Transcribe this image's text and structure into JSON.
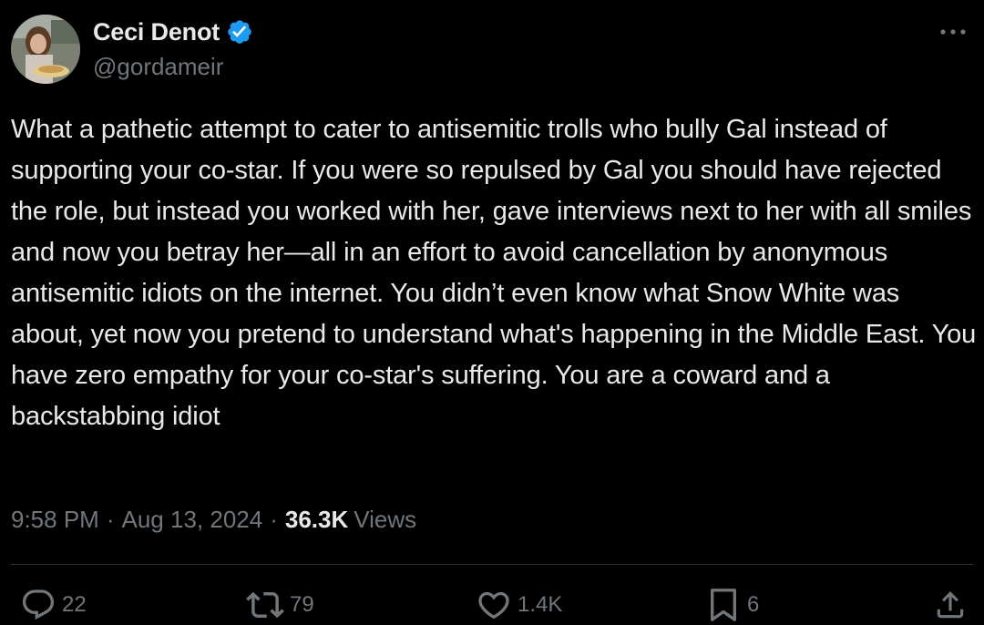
{
  "author": {
    "display_name": "Ceci Denot",
    "handle": "@gordameir",
    "verified": true
  },
  "tweet": {
    "text": "What a pathetic attempt to cater to antisemitic trolls who bully Gal instead of supporting your co-star. If you were so repulsed by Gal you should have rejected the role, but instead you worked with her, gave interviews next to her with all smiles and now you betray her—all in an effort to avoid cancellation by anonymous antisemitic idiots on the internet. You didn’t even know what Snow White was about, yet now you pretend to understand what's happening in the Middle East. You have zero empathy for your co-star's suffering. You are a coward and a backstabbing idiot",
    "time": "9:58 PM",
    "separator": "·",
    "date": "Aug 13, 2024",
    "views_count": "36.3K",
    "views_label": "Views"
  },
  "actions": {
    "replies": "22",
    "reposts": "79",
    "likes": "1.4K",
    "bookmarks": "6"
  },
  "icons": {
    "avatar": "profile-photo",
    "verified": "verified-badge-icon",
    "more": "more-options-icon",
    "reply": "reply-icon",
    "repost": "repost-icon",
    "like": "heart-icon",
    "bookmark": "bookmark-icon",
    "share": "share-icon"
  },
  "colors": {
    "background": "#000000",
    "text": "#e7e9ea",
    "secondary": "#71767b",
    "verified": "#1d9bf0",
    "divider": "#2f3336"
  }
}
